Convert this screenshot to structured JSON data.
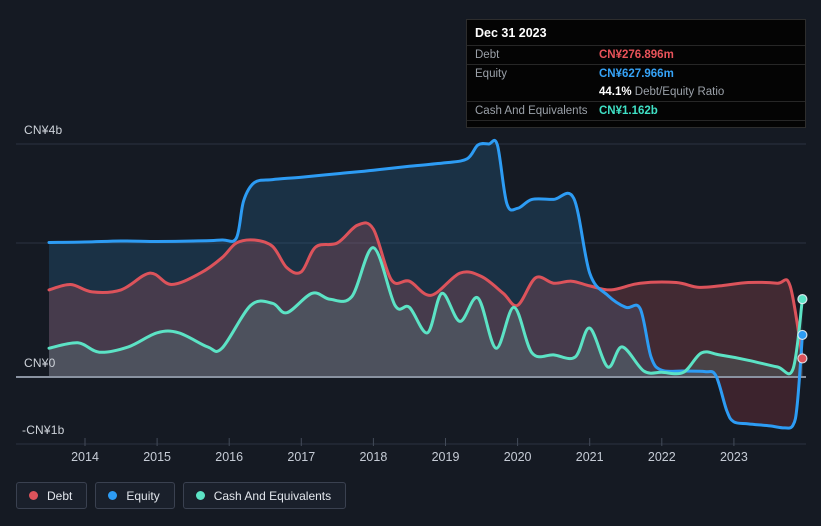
{
  "colors": {
    "background": "#151a23",
    "debt": "#dc535b",
    "equity": "#2d9cf4",
    "cash": "#5ce3c5",
    "grid": "#2b3240",
    "zero_line": "#8a93a1",
    "axis_text": "#ced3da",
    "debt_fill": "rgba(205,90,98,0.25)",
    "equity_fill": "rgba(46,134,193,0.22)",
    "cash_fill": "rgba(120,220,200,0.14)",
    "negative_fill": "rgba(200,70,80,0.22)"
  },
  "tooltip": {
    "date": "Dec 31 2023",
    "debt_label": "Debt",
    "debt_value": "CN¥276.896m",
    "equity_label": "Equity",
    "equity_value": "CN¥627.966m",
    "ratio_value": "44.1%",
    "ratio_label": " Debt/Equity Ratio",
    "cash_label": "Cash And Equivalents",
    "cash_value": "CN¥1.162b"
  },
  "legend": {
    "items": [
      {
        "label": "Debt",
        "color_key": "debt"
      },
      {
        "label": "Equity",
        "color_key": "equity"
      },
      {
        "label": "Cash And Equivalents",
        "color_key": "cash"
      }
    ]
  },
  "chart_data": {
    "type": "area",
    "unit": "CN¥ billions",
    "x_axis": {
      "years": [
        2014,
        2015,
        2016,
        2017,
        2018,
        2019,
        2020,
        2021,
        2022,
        2023
      ],
      "range": [
        2013.5,
        2023.95
      ]
    },
    "y_axis": {
      "labels": [
        {
          "text": "CN¥4b",
          "value": 4
        },
        {
          "text": "CN¥0",
          "value": 0
        },
        {
          "text": "-CN¥1b",
          "value": -1
        }
      ],
      "unlabeled_gridline_value": 2,
      "ylim": [
        -1,
        4.2
      ]
    },
    "series": [
      {
        "name": "Equity",
        "color_key": "equity",
        "points": [
          [
            2013.5,
            2.01
          ],
          [
            2014,
            2.02
          ],
          [
            2014.5,
            2.04
          ],
          [
            2015,
            2.03
          ],
          [
            2015.5,
            2.04
          ],
          [
            2015.9,
            2.06
          ],
          [
            2016.1,
            2.1
          ],
          [
            2016.2,
            2.85
          ],
          [
            2016.35,
            3.22
          ],
          [
            2016.6,
            3.28
          ],
          [
            2017,
            3.33
          ],
          [
            2017.5,
            3.4
          ],
          [
            2018,
            3.47
          ],
          [
            2018.5,
            3.55
          ],
          [
            2019,
            3.62
          ],
          [
            2019.3,
            3.7
          ],
          [
            2019.45,
            3.98
          ],
          [
            2019.6,
            4.0
          ],
          [
            2019.72,
            3.98
          ],
          [
            2019.85,
            2.8
          ],
          [
            2020,
            2.7
          ],
          [
            2020.2,
            2.88
          ],
          [
            2020.5,
            2.88
          ],
          [
            2020.78,
            2.9
          ],
          [
            2021,
            1.55
          ],
          [
            2021.25,
            1.22
          ],
          [
            2021.5,
            1.04
          ],
          [
            2021.7,
            1.02
          ],
          [
            2021.85,
            0.3
          ],
          [
            2022,
            0.1
          ],
          [
            2022.3,
            0.09
          ],
          [
            2022.6,
            0.08
          ],
          [
            2022.75,
            0.02
          ],
          [
            2022.9,
            -0.5
          ],
          [
            2023,
            -0.67
          ],
          [
            2023.2,
            -0.7
          ],
          [
            2023.5,
            -0.73
          ],
          [
            2023.7,
            -0.76
          ],
          [
            2023.82,
            -0.72
          ],
          [
            2023.88,
            -0.4
          ],
          [
            2023.95,
            0.628
          ]
        ]
      },
      {
        "name": "Debt",
        "color_key": "debt",
        "points": [
          [
            2013.5,
            1.3
          ],
          [
            2013.8,
            1.38
          ],
          [
            2014.1,
            1.27
          ],
          [
            2014.5,
            1.3
          ],
          [
            2014.9,
            1.55
          ],
          [
            2015.2,
            1.38
          ],
          [
            2015.6,
            1.55
          ],
          [
            2015.9,
            1.78
          ],
          [
            2016.1,
            2.0
          ],
          [
            2016.35,
            2.06
          ],
          [
            2016.6,
            1.95
          ],
          [
            2016.8,
            1.63
          ],
          [
            2017,
            1.57
          ],
          [
            2017.2,
            1.94
          ],
          [
            2017.5,
            2.0
          ],
          [
            2017.78,
            2.36
          ],
          [
            2018,
            2.28
          ],
          [
            2018.25,
            1.45
          ],
          [
            2018.5,
            1.43
          ],
          [
            2018.8,
            1.22
          ],
          [
            2019.2,
            1.55
          ],
          [
            2019.5,
            1.5
          ],
          [
            2019.8,
            1.25
          ],
          [
            2020,
            1.07
          ],
          [
            2020.25,
            1.48
          ],
          [
            2020.5,
            1.4
          ],
          [
            2020.75,
            1.43
          ],
          [
            2021,
            1.36
          ],
          [
            2021.3,
            1.3
          ],
          [
            2021.7,
            1.4
          ],
          [
            2022.2,
            1.41
          ],
          [
            2022.5,
            1.34
          ],
          [
            2022.8,
            1.36
          ],
          [
            2023.2,
            1.41
          ],
          [
            2023.6,
            1.4
          ],
          [
            2023.78,
            1.36
          ],
          [
            2023.95,
            0.277
          ]
        ]
      },
      {
        "name": "Cash And Equivalents",
        "color_key": "cash",
        "points": [
          [
            2013.5,
            0.43
          ],
          [
            2013.9,
            0.51
          ],
          [
            2014.2,
            0.37
          ],
          [
            2014.6,
            0.45
          ],
          [
            2015,
            0.66
          ],
          [
            2015.3,
            0.66
          ],
          [
            2015.7,
            0.45
          ],
          [
            2015.9,
            0.43
          ],
          [
            2016.3,
            1.07
          ],
          [
            2016.6,
            1.1
          ],
          [
            2016.8,
            0.96
          ],
          [
            2017.15,
            1.25
          ],
          [
            2017.4,
            1.16
          ],
          [
            2017.7,
            1.2
          ],
          [
            2018,
            1.93
          ],
          [
            2018.3,
            1.07
          ],
          [
            2018.5,
            1.04
          ],
          [
            2018.75,
            0.66
          ],
          [
            2018.95,
            1.25
          ],
          [
            2019.2,
            0.83
          ],
          [
            2019.45,
            1.18
          ],
          [
            2019.7,
            0.43
          ],
          [
            2019.95,
            1.04
          ],
          [
            2020.2,
            0.36
          ],
          [
            2020.5,
            0.33
          ],
          [
            2020.8,
            0.3
          ],
          [
            2021,
            0.73
          ],
          [
            2021.25,
            0.15
          ],
          [
            2021.45,
            0.45
          ],
          [
            2021.75,
            0.09
          ],
          [
            2022,
            0.07
          ],
          [
            2022.3,
            0.07
          ],
          [
            2022.55,
            0.36
          ],
          [
            2022.8,
            0.33
          ],
          [
            2023.2,
            0.25
          ],
          [
            2023.6,
            0.15
          ],
          [
            2023.82,
            0.12
          ],
          [
            2023.95,
            1.162
          ]
        ]
      }
    ],
    "end_values": {
      "Equity": 0.628,
      "Debt": 0.277,
      "Cash And Equivalents": 1.162
    }
  }
}
